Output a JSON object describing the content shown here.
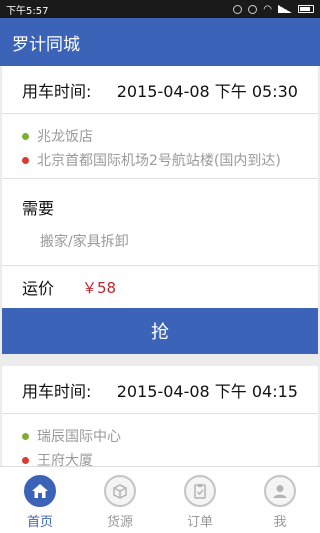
{
  "status_bar": {
    "time": "下午5:57"
  },
  "app_bar": {
    "title": "罗计同城"
  },
  "orders": [
    {
      "time_label": "用车时间:",
      "time_value": "2015-04-08 下午 05:30",
      "origin": "兆龙饭店",
      "destination": "北京首都国际机场2号航站楼(国内到达)",
      "need_label": "需要",
      "need_value": "搬家/家具拆卸",
      "price_label": "运价",
      "price_value": "￥58",
      "grab_label": "抢"
    },
    {
      "time_label": "用车时间:",
      "time_value": "2015-04-08 下午 04:15",
      "origin": "瑞辰国际中心",
      "destination": "王府大厦"
    }
  ],
  "tabs": [
    {
      "label": "首页",
      "icon": "home-icon",
      "active": true
    },
    {
      "label": "货源",
      "icon": "box-icon",
      "active": false
    },
    {
      "label": "订单",
      "icon": "clipboard-icon",
      "active": false
    },
    {
      "label": "我",
      "icon": "user-icon",
      "active": false
    }
  ],
  "colors": {
    "brand": "#3b63b8",
    "price": "#c0262c",
    "origin_dot": "#7eb02f",
    "destination_dot": "#dd3a2b"
  }
}
